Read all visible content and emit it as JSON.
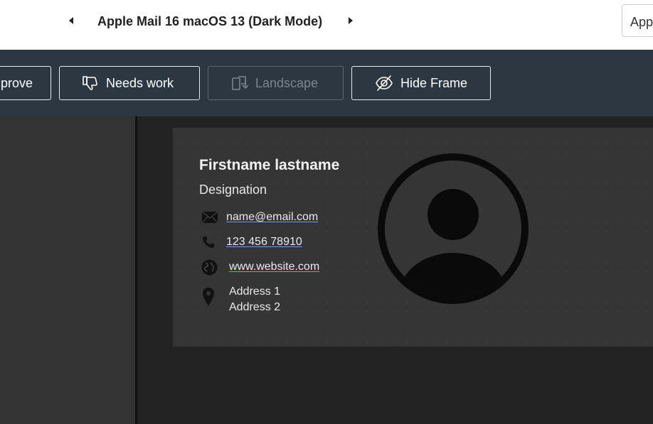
{
  "header": {
    "prev_label": "previous client",
    "client_title": "Apple Mail 16 macOS 13 (Dark Mode)",
    "next_label": "next client",
    "selector_value": "App"
  },
  "toolbar": {
    "approve_label": "prove",
    "needs_work_label": "Needs work",
    "landscape_label": "Landscape",
    "hide_frame_label": "Hide Frame"
  },
  "signature": {
    "name": "Firstname lastname",
    "designation": "Designation",
    "email": "name@email.com",
    "phone": "123 456 78910",
    "website": "www.website.com",
    "address_1": "Address 1",
    "address_2": "Address 2"
  },
  "icons": {
    "prev": "caret-left-icon",
    "next": "caret-right-icon",
    "needs_work": "thumbs-down-icon",
    "landscape": "rotate-screen-icon",
    "hide_frame": "eye-off-icon",
    "email": "envelope-icon",
    "phone": "phone-icon",
    "website": "globe-icon",
    "address": "map-pin-icon",
    "avatar": "user-avatar-icon"
  },
  "colors": {
    "toolbar_bg": "#2b3841",
    "preview_bg": "#353535",
    "canvas_bg": "#232323",
    "link_underline": "#6fa0d8"
  }
}
